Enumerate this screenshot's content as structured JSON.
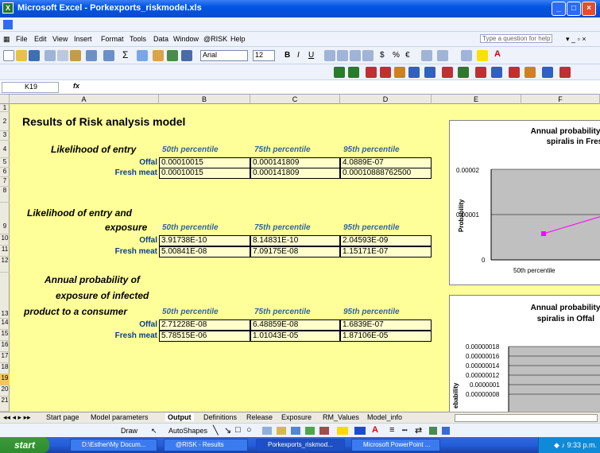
{
  "window": {
    "title": "Microsoft Excel - Porkexports_riskmodel.xls"
  },
  "menu": [
    "File",
    "Edit",
    "View",
    "Insert",
    "Format",
    "Tools",
    "Data",
    "Window",
    "@RISK",
    "Help"
  ],
  "help_placeholder": "Type a question for help",
  "font": {
    "name": "Arial",
    "size": "12"
  },
  "formula_bar": {
    "cell_ref": "K19",
    "fx": "fx"
  },
  "columns": [
    "A",
    "B",
    "C",
    "D",
    "E",
    "F"
  ],
  "rows": [
    "1",
    "2",
    "3",
    "4",
    "5",
    "6",
    "7",
    "8",
    "9",
    "10",
    "11",
    "12",
    "13",
    "14",
    "15",
    "16",
    "17",
    "18",
    "19",
    "20",
    "21"
  ],
  "sheet": {
    "heading": "Results of Risk analysis model",
    "percentiles": [
      "50th percentile",
      "75th percentile",
      "95th percentile"
    ],
    "entry": {
      "label": "Likelihood of entry",
      "rows": [
        {
          "name": "Offal",
          "values": [
            "0.00010015",
            "0.000141809",
            "4.0889E-07"
          ]
        },
        {
          "name": "Fresh meat",
          "values": [
            "0.00010015",
            "0.000141809",
            "0.00010888762500"
          ]
        }
      ]
    },
    "exposure": {
      "label1": "Likelihood of entry and",
      "label2": "exposure",
      "rows": [
        {
          "name": "Offal",
          "values": [
            "3.91738E-10",
            "8.14831E-10",
            "2.04593E-09"
          ]
        },
        {
          "name": "Fresh meat",
          "values": [
            "5.00841E-08",
            "7.09175E-08",
            "1.15171E-07"
          ]
        }
      ]
    },
    "annual": {
      "label1": "Annual probability of",
      "label2": "exposure of infected",
      "label3": "product to a consumer",
      "rows": [
        {
          "name": "Offal",
          "values": [
            "2.71228E-08",
            "6.48859E-08",
            "1.6839E-07"
          ]
        },
        {
          "name": "Fresh meat",
          "values": [
            "5.78515E-06",
            "1.01043E-05",
            "1.87106E-05"
          ]
        }
      ]
    }
  },
  "charts": [
    {
      "title1": "Annual probability of e",
      "title2": "spiralis  in Fresh m",
      "ylabel": "Probability",
      "yticks": [
        "0.00002",
        "0.00001",
        "0"
      ],
      "xlabel": "50th percentile",
      "xlabel2": "7"
    },
    {
      "title1": "Annual probability of e",
      "title2": "spiralis  in Offal",
      "ylabel": "ebability",
      "yticks": [
        "0.00000018",
        "0.00000016",
        "0.00000014",
        "0.00000012",
        "0.0000001",
        "0.00000008"
      ]
    }
  ],
  "chart_data": [
    {
      "type": "line",
      "title": "Annual probability of e spiralis  in Fresh m",
      "ylabel": "Probability",
      "categories": [
        "50th percentile",
        "7"
      ],
      "values": [
        5.78515e-06,
        1.01043e-05
      ],
      "ylim": [
        0,
        2e-05
      ]
    },
    {
      "type": "line",
      "title": "Annual probability of e spiralis  in Offal",
      "ylabel": "ebability",
      "ylim": [
        8e-08,
        1.8e-07
      ]
    }
  ],
  "sheet_tabs": [
    "Start page",
    "Model parameters",
    "Output",
    "Definitions",
    "Release",
    "Exposure",
    "RM_Values",
    "Model_info"
  ],
  "active_tab": "Output",
  "draw": {
    "draw": "Draw",
    "autoshapes": "AutoShapes"
  },
  "taskbar": {
    "start": "start",
    "items": [
      "D:\\Esther\\My Docum...",
      "@RISK - Results",
      "Porkexports_riskmod...",
      "Microsoft PowerPoint ..."
    ],
    "clock": "9:33 p.m."
  }
}
